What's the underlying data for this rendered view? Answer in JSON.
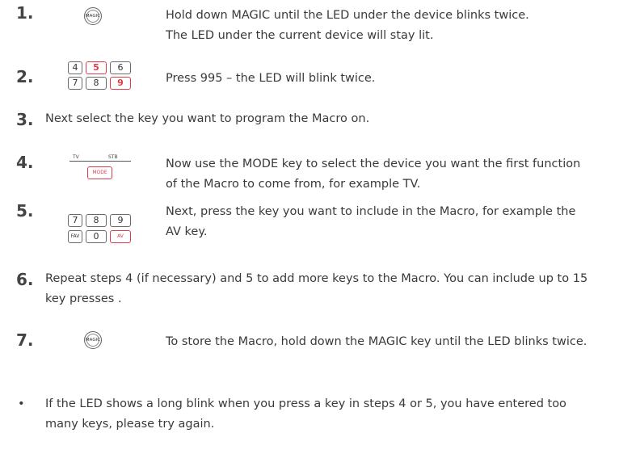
{
  "steps": [
    {
      "num": "1.",
      "lines": [
        "Hold down MAGIC until the LED under the device blinks twice.",
        "The LED under the current device will stay lit."
      ]
    },
    {
      "num": "2.",
      "lines": [
        "Press 995 – the LED will blink twice."
      ]
    },
    {
      "num": "3.",
      "lines": [
        "Next select the key you want to program the Macro on."
      ]
    },
    {
      "num": "4.",
      "lines": [
        "Now use the MODE key to select the device you want the first function",
        "of the Macro to come from, for example TV."
      ]
    },
    {
      "num": "5.",
      "lines": [
        "Next, press the key you want to include in the Macro, for example the",
        "AV key."
      ]
    },
    {
      "num": "6.",
      "lines": [
        "Repeat steps 4 (if necessary) and 5 to add more keys to the Macro. You can include up to 15",
        "key presses ."
      ]
    },
    {
      "num": "7.",
      "lines": [
        "To store the Macro, hold down the MAGIC key until the LED blinks twice."
      ]
    }
  ],
  "note": {
    "bullet": "•",
    "lines": [
      "If the LED shows a long blink when you press a key in steps 4 or 5, you have entered too",
      "many keys, please try again."
    ]
  },
  "icons": {
    "magic_label": "MAGIC",
    "keypad2_row1": [
      "4",
      "5",
      "6"
    ],
    "keypad2_row2": [
      "7",
      "8",
      "9"
    ],
    "mode_tv": "TV",
    "mode_stb": "STB",
    "mode_label": "MODE",
    "keypad5_row1": [
      "7",
      "8",
      "9"
    ],
    "keypad5_row2": [
      "FAV",
      "0",
      "AV"
    ],
    "accent_color": "#e03a4a"
  }
}
